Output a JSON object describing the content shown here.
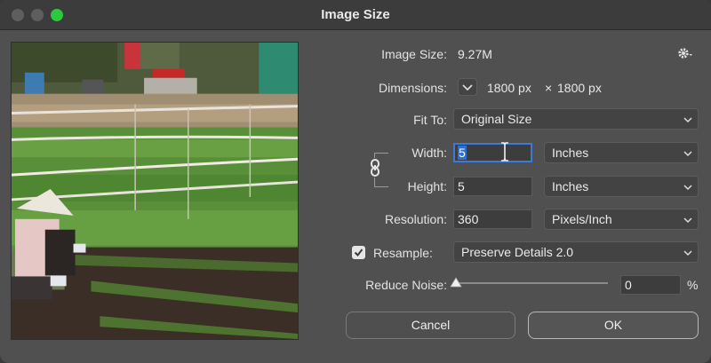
{
  "window": {
    "title": "Image Size"
  },
  "info": {
    "image_size_label": "Image Size:",
    "image_size_value": "9.27M",
    "dimensions_label": "Dimensions:",
    "dimensions_w": "1800 px",
    "dimensions_sep": "×",
    "dimensions_h": "1800 px"
  },
  "fit_to": {
    "label": "Fit To:",
    "value": "Original Size"
  },
  "width": {
    "label": "Width:",
    "value": "5",
    "unit": "Inches"
  },
  "height": {
    "label": "Height:",
    "value": "5",
    "unit": "Inches"
  },
  "resolution": {
    "label": "Resolution:",
    "value": "360",
    "unit": "Pixels/Inch"
  },
  "resample": {
    "label": "Resample:",
    "checked": true,
    "value": "Preserve Details 2.0"
  },
  "reduce_noise": {
    "label": "Reduce Noise:",
    "value": "0",
    "unit": "%"
  },
  "buttons": {
    "cancel": "Cancel",
    "ok": "OK"
  },
  "icons": {
    "close": "close-traffic-light",
    "minimize": "minimize-traffic-light",
    "maximize": "maximize-traffic-light",
    "settings": "gear-icon",
    "dimensions_menu": "chevron-down-icon",
    "constrain": "link-icon",
    "checkbox": "checkmark-icon",
    "slider": "slider-thumb"
  },
  "colors": {
    "accent": "#3b7ad8",
    "maximize": "#2cc840",
    "dialog_bg": "#505050"
  }
}
